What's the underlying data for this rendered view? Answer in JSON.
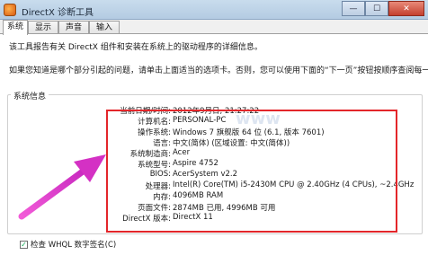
{
  "window": {
    "title": "DirectX 诊断工具",
    "minimize_glyph": "—",
    "maximize_glyph": "☐",
    "close_glyph": "✕"
  },
  "tabs": [
    {
      "label": "系统",
      "active": true
    },
    {
      "label": "显示",
      "active": false
    },
    {
      "label": "声音",
      "active": false
    },
    {
      "label": "输入",
      "active": false
    }
  ],
  "intro": {
    "line1": "该工具报告有关 DirectX 组件和安装在系统上的驱动程序的详细信息。",
    "line2": "如果您知道是哪个部分引起的问题，请单击上面适当的选项卡。否则，您可以使用下面的“下一页”按钮按顺序查阅每一页。"
  },
  "system_info": {
    "group_title": "系统信息",
    "rows": [
      {
        "label": "当前日期/时间:",
        "value": "2012年9月日, 21:27:22"
      },
      {
        "label": "计算机名:",
        "value": "PERSONAL-PC"
      },
      {
        "label": "操作系统:",
        "value": "Windows 7 旗舰版 64 位 (6.1, 版本 7601)"
      },
      {
        "label": "语言:",
        "value": "中文(简体) (区域设置: 中文(简体))"
      },
      {
        "label": "系统制造商:",
        "value": "Acer"
      },
      {
        "label": "系统型号:",
        "value": "Aspire 4752"
      },
      {
        "label": "BIOS:",
        "value": "AcerSystem v2.2"
      },
      {
        "label": "处理器:",
        "value": "Intel(R) Core(TM) i5-2430M CPU @ 2.40GHz (4 CPUs), ~2.4GHz"
      },
      {
        "label": "内存:",
        "value": "4096MB RAM"
      },
      {
        "label": "页面文件:",
        "value": "2874MB 已用, 4996MB 可用"
      },
      {
        "label": "DirectX 版本:",
        "value": "DirectX 11"
      }
    ]
  },
  "footer": {
    "whql_label": "检查 WHQL 数字签名(C)",
    "whql_checked": true,
    "check_glyph": "✓"
  },
  "colors": {
    "highlight_border": "#e3262a",
    "arrow": "#e040c8"
  }
}
